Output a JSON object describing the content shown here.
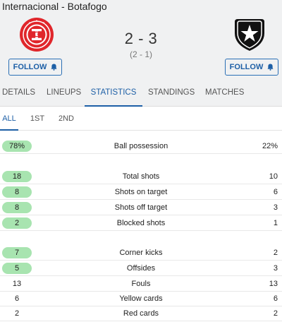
{
  "match": {
    "title": "Internacional - Botafogo",
    "score": "2 - 3",
    "half_time": "(2 - 1)"
  },
  "home": {
    "crest_icon": "internacional-crest-icon",
    "color": "#e0262b",
    "follow_label": "FOLLOW"
  },
  "away": {
    "crest_icon": "botafogo-crest-icon",
    "color": "#111111",
    "follow_label": "FOLLOW"
  },
  "tabs": [
    "DETAILS",
    "LINEUPS",
    "STATISTICS",
    "STANDINGS",
    "MATCHES"
  ],
  "active_tab": "STATISTICS",
  "periods": [
    "ALL",
    "1ST",
    "2ND"
  ],
  "active_period": "ALL",
  "colors": {
    "accent": "#1d5fa6",
    "highlight": "#a8e4b0",
    "header_bg": "#f0f1f2"
  },
  "stats": [
    {
      "label": "Ball possession",
      "home": "78%",
      "away": "22%",
      "highlight_home": true
    },
    {
      "label": "Total shots",
      "home": "18",
      "away": "10",
      "highlight_home": true
    },
    {
      "label": "Shots on target",
      "home": "8",
      "away": "6",
      "highlight_home": true
    },
    {
      "label": "Shots off target",
      "home": "8",
      "away": "3",
      "highlight_home": true
    },
    {
      "label": "Blocked shots",
      "home": "2",
      "away": "1",
      "highlight_home": true
    },
    {
      "label": "Corner kicks",
      "home": "7",
      "away": "2",
      "highlight_home": true
    },
    {
      "label": "Offsides",
      "home": "5",
      "away": "3",
      "highlight_home": true
    },
    {
      "label": "Fouls",
      "home": "13",
      "away": "13",
      "highlight_home": false
    },
    {
      "label": "Yellow cards",
      "home": "6",
      "away": "6",
      "highlight_home": false
    },
    {
      "label": "Red cards",
      "home": "2",
      "away": "2",
      "highlight_home": false
    }
  ]
}
